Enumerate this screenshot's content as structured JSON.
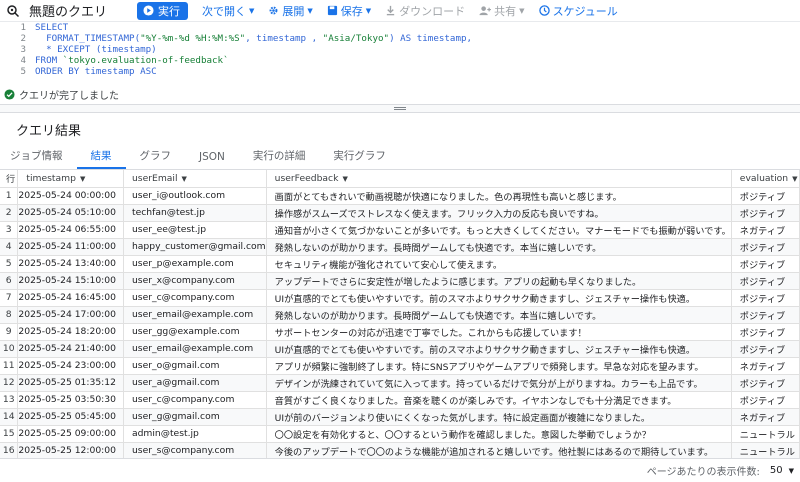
{
  "toolbar": {
    "title": "無題のクエリ",
    "run_label": "実行",
    "schedule_next_label": "次で開く",
    "expand_label": "展開",
    "save_label": "保存",
    "download_label": "ダウンロード",
    "share_label": "共有",
    "schedule_label": "スケジュール"
  },
  "editor": {
    "lines": [
      {
        "num": "1",
        "text": "SELECT"
      },
      {
        "num": "2",
        "text": "  FORMAT_TIMESTAMP(\"%Y-%m-%d %H:%M:%S\", timestamp , \"Asia/Tokyo\") AS timestamp,"
      },
      {
        "num": "3",
        "text": "  * EXCEPT (timestamp)"
      },
      {
        "num": "4",
        "text": "FROM `tokyo.evaluation-of-feedback`"
      },
      {
        "num": "5",
        "text": "ORDER BY timestamp ASC"
      }
    ]
  },
  "status": {
    "text": "クエリが完了しました"
  },
  "results": {
    "title": "クエリ結果"
  },
  "tabs": [
    {
      "label": "ジョブ情報"
    },
    {
      "label": "結果"
    },
    {
      "label": "グラフ"
    },
    {
      "label": "JSON"
    },
    {
      "label": "実行の詳細"
    },
    {
      "label": "実行グラフ"
    }
  ],
  "table": {
    "columns": [
      "行",
      "timestamp",
      "userEmail",
      "userFeedback",
      "evaluation"
    ],
    "rows": [
      [
        "1",
        "2025-05-24 00:00:00",
        "user_i@outlook.com",
        "画面がとてもきれいで動画視聴が快適になりました。色の再現性も高いと感じます。",
        "ポジティブ"
      ],
      [
        "2",
        "2025-05-24 05:10:00",
        "techfan@test.jp",
        "操作感がスムーズでストレスなく使えます。フリック入力の反応も良いですね。",
        "ポジティブ"
      ],
      [
        "3",
        "2025-05-24 06:55:00",
        "user_ee@test.jp",
        "通知音が小さくて気づかないことが多いです。もっと大きくしてください。マナーモードでも振動が弱いです。",
        "ネガティブ"
      ],
      [
        "4",
        "2025-05-24 11:00:00",
        "happy_customer@gmail.com",
        "発熱しないのが助かります。長時間ゲームしても快適です。本当に嬉しいです。",
        "ポジティブ"
      ],
      [
        "5",
        "2025-05-24 13:40:00",
        "user_p@example.com",
        "セキュリティ機能が強化されていて安心して使えます。",
        "ポジティブ"
      ],
      [
        "6",
        "2025-05-24 15:10:00",
        "user_x@company.com",
        "アップデートでさらに安定性が増したように感じます。アプリの起動も早くなりました。",
        "ポジティブ"
      ],
      [
        "7",
        "2025-05-24 16:45:00",
        "user_c@company.com",
        "UIが直感的でとても使いやすいです。前のスマホよりサクサク動きますし、ジェスチャー操作も快適。",
        "ポジティブ"
      ],
      [
        "8",
        "2025-05-24 17:00:00",
        "user_email@example.com",
        "発熱しないのが助かります。長時間ゲームしても快適です。本当に嬉しいです。",
        "ポジティブ"
      ],
      [
        "9",
        "2025-05-24 18:20:00",
        "user_gg@example.com",
        "サポートセンターの対応が迅速で丁寧でした。これからも応援しています！",
        "ポジティブ"
      ],
      [
        "10",
        "2025-05-24 21:40:00",
        "user_email@example.com",
        "UIが直感的でとても使いやすいです。前のスマホよりサクサク動きますし、ジェスチャー操作も快適。",
        "ポジティブ"
      ],
      [
        "11",
        "2025-05-24 23:00:00",
        "user_o@gmail.com",
        "アプリが頻繁に強制終了します。特にSNSアプリやゲームアプリで頻発します。早急な対応を望みます。",
        "ネガティブ"
      ],
      [
        "12",
        "2025-05-25 01:35:12",
        "user_a@gmail.com",
        "デザインが洗練されていて気に入ってます。持っているだけで気分が上がりますね。カラーも上品です。",
        "ポジティブ"
      ],
      [
        "13",
        "2025-05-25 03:50:30",
        "user_c@company.com",
        "音質がすごく良くなりました。音楽を聴くのが楽しみです。イヤホンなしでも十分満足できます。",
        "ポジティブ"
      ],
      [
        "14",
        "2025-05-25 05:45:00",
        "user_g@gmail.com",
        "UIが前のバージョンより使いにくくなった気がします。特に設定画面が複雑になりました。",
        "ネガティブ"
      ],
      [
        "15",
        "2025-05-25 09:00:00",
        "admin@test.jp",
        "〇〇設定を有効化すると、〇〇するという動作を確認しました。意図した挙動でしょうか？",
        "ニュートラル"
      ],
      [
        "16",
        "2025-05-25 12:00:00",
        "user_s@company.com",
        "今後のアップデートで〇〇のような機能が追加されると嬉しいです。他社製にはあるので期待しています。",
        "ニュートラル"
      ]
    ]
  },
  "footer": {
    "per_page_label": "ページあたりの表示件数:",
    "per_page_value": "50"
  },
  "colors": {
    "accent": "#1a73e8",
    "success": "#188038"
  }
}
